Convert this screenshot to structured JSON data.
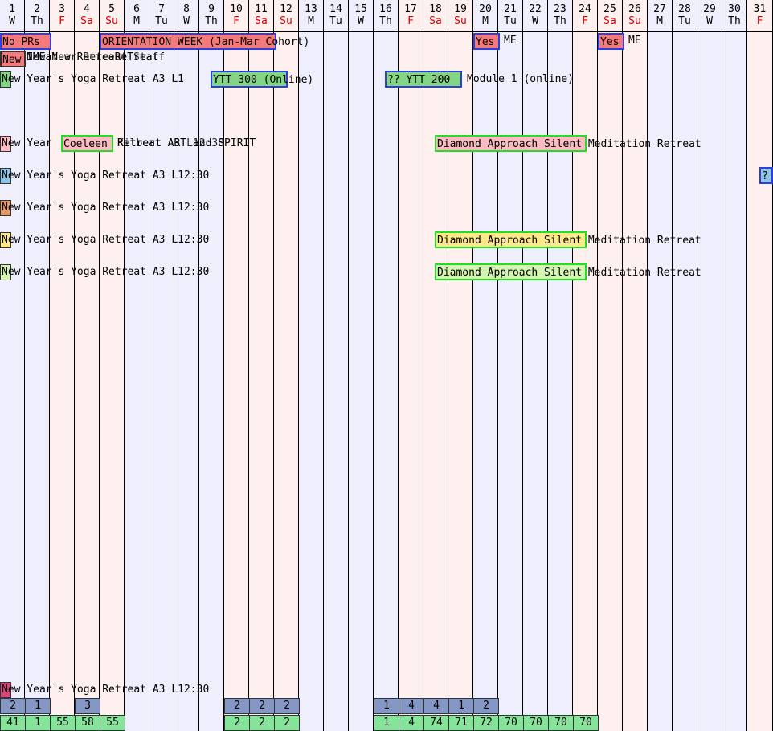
{
  "calendar": {
    "days": [
      {
        "num": "1",
        "dow": "W",
        "weekend": false
      },
      {
        "num": "2",
        "dow": "Th",
        "weekend": false
      },
      {
        "num": "3",
        "dow": "F",
        "weekend": true
      },
      {
        "num": "4",
        "dow": "Sa",
        "weekend": true
      },
      {
        "num": "5",
        "dow": "Su",
        "weekend": true
      },
      {
        "num": "6",
        "dow": "M",
        "weekend": false
      },
      {
        "num": "7",
        "dow": "Tu",
        "weekend": false
      },
      {
        "num": "8",
        "dow": "W",
        "weekend": false
      },
      {
        "num": "9",
        "dow": "Th",
        "weekend": false
      },
      {
        "num": "10",
        "dow": "F",
        "weekend": true
      },
      {
        "num": "11",
        "dow": "Sa",
        "weekend": true
      },
      {
        "num": "12",
        "dow": "Su",
        "weekend": true
      },
      {
        "num": "13",
        "dow": "M",
        "weekend": false
      },
      {
        "num": "14",
        "dow": "Tu",
        "weekend": false
      },
      {
        "num": "15",
        "dow": "W",
        "weekend": false
      },
      {
        "num": "16",
        "dow": "Th",
        "weekend": false
      },
      {
        "num": "17",
        "dow": "F",
        "weekend": true
      },
      {
        "num": "18",
        "dow": "Sa",
        "weekend": true
      },
      {
        "num": "19",
        "dow": "Su",
        "weekend": true
      },
      {
        "num": "20",
        "dow": "M",
        "weekend": false
      },
      {
        "num": "21",
        "dow": "Tu",
        "weekend": false
      },
      {
        "num": "22",
        "dow": "W",
        "weekend": false
      },
      {
        "num": "23",
        "dow": "Th",
        "weekend": false
      },
      {
        "num": "24",
        "dow": "F",
        "weekend": true
      },
      {
        "num": "25",
        "dow": "Sa",
        "weekend": true
      },
      {
        "num": "26",
        "dow": "Su",
        "weekend": true
      },
      {
        "num": "27",
        "dow": "M",
        "weekend": false
      },
      {
        "num": "28",
        "dow": "Tu",
        "weekend": false
      },
      {
        "num": "29",
        "dow": "W",
        "weekend": false
      },
      {
        "num": "30",
        "dow": "Th",
        "weekend": false
      },
      {
        "num": "31",
        "dow": "F",
        "weekend": true
      }
    ]
  },
  "events": {
    "no_prs": "No PRs",
    "orientation_week": "ORIENTATION WEEK (Jan-Mar Cohort)",
    "yes_20": "Yes",
    "me_21": "ME",
    "yes_25": "Yes",
    "me_26": "ME",
    "row2_new": "New",
    "row2_overlap": "IMEaNew RetreaReTreat",
    "row2_overlap_b": "New Year Retreat Staff",
    "yoga_retreat": "New Year's Yoga Retreat A3 L12:30",
    "yoga_retreat_truncated": "New Year's Yoga Retreat A3 L1",
    "ytt300": "YTT 300 (Online)",
    "ytt200": "?? YTT 200",
    "module1": "Module 1 (online)",
    "new_year": "New Year",
    "coeleen": "Coeleen",
    "coeleen_overlap": "Retreat ART and SPIRIT",
    "coeleen_overlap_b": "Kilbert A3 L12:30",
    "diamond": "Diamond Approach Silent Meditation Retreat",
    "question": "?"
  },
  "colors": {
    "weekday_bg": "#eeeefc",
    "weekend_bg": "#fdf0ef",
    "weekend_text": "#d40000",
    "salmon": "#f4797b",
    "green": "#83d483",
    "pink": "#f9bcc0",
    "sky": "#8fc4e8",
    "tan": "#e59a6a",
    "yellow": "#fde98a",
    "lime": "#d4f4b4",
    "magenta": "#d9447d",
    "count_blue": "#8497c4",
    "count_green": "#85e39a"
  },
  "counts": {
    "row1": [
      "2",
      "1",
      "",
      "3",
      "",
      "",
      "",
      "",
      "",
      "2",
      "2",
      "2",
      "",
      "",
      "",
      "1",
      "4",
      "4",
      "1",
      "2"
    ],
    "row2": [
      "41",
      "1",
      "55",
      "58",
      "55",
      "",
      "",
      "",
      "",
      "2",
      "2",
      "2",
      "",
      "",
      "",
      "1",
      "4",
      "74",
      "71",
      "72",
      "70",
      "70",
      "70",
      "70"
    ]
  }
}
